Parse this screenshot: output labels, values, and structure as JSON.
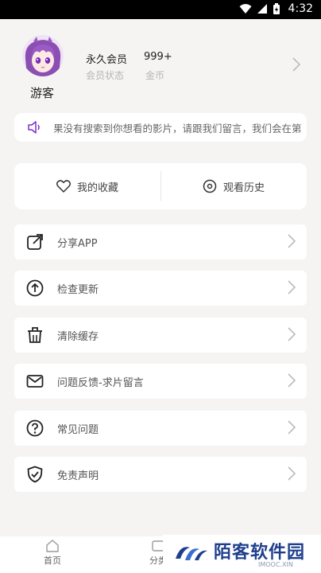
{
  "status_bar": {
    "time": "4:32"
  },
  "profile": {
    "name": "游客",
    "membership_value": "永久会员",
    "membership_label": "会员状态",
    "coins_value": "999+",
    "coins_label": "金币"
  },
  "notice": {
    "text": "果没有搜索到你想看的影片，请跟我们留言，我们会在第"
  },
  "quick_actions": {
    "favorites": "我的收藏",
    "history": "观看历史"
  },
  "menu": [
    {
      "label": "分享APP",
      "icon": "share-icon"
    },
    {
      "label": "检查更新",
      "icon": "upload-icon"
    },
    {
      "label": "清除缓存",
      "icon": "trash-icon"
    },
    {
      "label": "问题反馈-求片留言",
      "icon": "mail-icon"
    },
    {
      "label": "常见问题",
      "icon": "question-icon"
    },
    {
      "label": "免责声明",
      "icon": "shield-check-icon"
    }
  ],
  "tabbar": {
    "home": "首页",
    "category": "分类"
  },
  "watermark": {
    "brand": "陌客软件园",
    "sub": "IMOOC.XIN"
  },
  "colors": {
    "accent": "#7b2fd0",
    "background": "#f6f4f3",
    "card": "#ffffff"
  }
}
